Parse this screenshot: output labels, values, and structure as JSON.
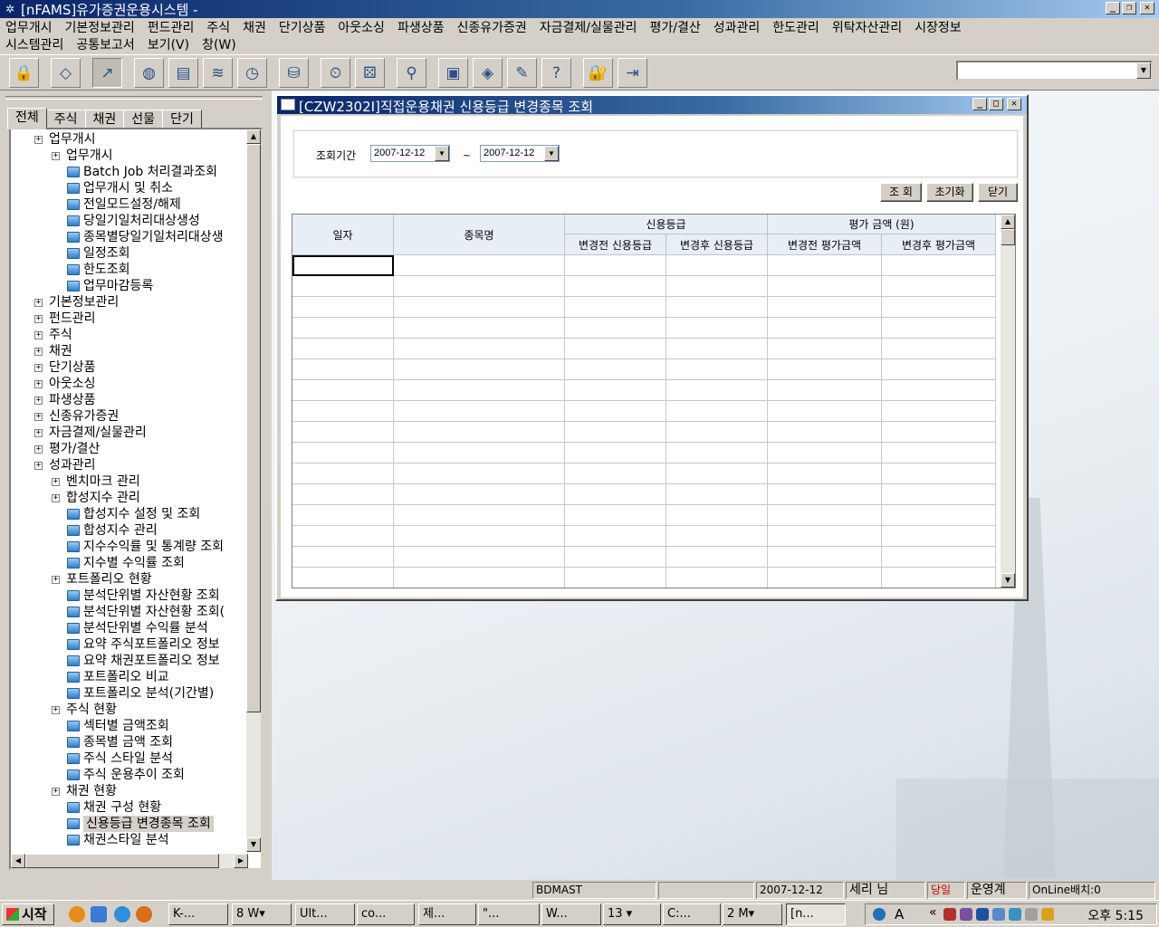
{
  "window": {
    "title": "[nFAMS]유가증권운용시스템 -"
  },
  "menu": {
    "row1": [
      "업무개시",
      "기본정보관리",
      "펀드관리",
      "주식",
      "채권",
      "단기상품",
      "아웃소싱",
      "파생상품",
      "신종유가증권",
      "자금결제/실물관리",
      "평가/결산",
      "성과관리",
      "한도관리",
      "위탁자산관리",
      "시장정보"
    ],
    "row2": [
      "시스템관리",
      "공통보고서",
      "보기(V)",
      "창(W)"
    ]
  },
  "toolbar": {
    "icons": [
      "lock-icon",
      "eraser-icon",
      "navigate-icon",
      "globe-icon",
      "document-refresh-icon",
      "stack-icon",
      "document-clock-icon",
      "database-icon",
      "clock-icon",
      "dice-icon",
      "search-icon",
      "box-icon",
      "package-icon",
      "clipboard-icon",
      "help-icon",
      "padlock-icon",
      "exit-icon"
    ],
    "combo_value": ""
  },
  "left_panel": {
    "tabs": [
      "전체",
      "주식",
      "채권",
      "선물",
      "단기"
    ],
    "active_tab": "전체",
    "tree": [
      {
        "label": "업무개시",
        "level": 0,
        "type": "folder"
      },
      {
        "label": "업무개시",
        "level": 1,
        "type": "folder"
      },
      {
        "label": "Batch Job 처리결과조회",
        "level": 2,
        "type": "doc"
      },
      {
        "label": "업무개시 및 취소",
        "level": 2,
        "type": "doc"
      },
      {
        "label": "전일모드설정/해제",
        "level": 2,
        "type": "doc"
      },
      {
        "label": "당일기일처리대상생성",
        "level": 2,
        "type": "doc"
      },
      {
        "label": "종목별당일기일처리대상생",
        "level": 2,
        "type": "doc"
      },
      {
        "label": "일정조회",
        "level": 2,
        "type": "doc"
      },
      {
        "label": "한도조회",
        "level": 2,
        "type": "doc"
      },
      {
        "label": "업무마감등록",
        "level": 2,
        "type": "doc"
      },
      {
        "label": "기본정보관리",
        "level": 0,
        "type": "folder"
      },
      {
        "label": "펀드관리",
        "level": 0,
        "type": "folder"
      },
      {
        "label": "주식",
        "level": 0,
        "type": "folder"
      },
      {
        "label": "채권",
        "level": 0,
        "type": "folder"
      },
      {
        "label": "단기상품",
        "level": 0,
        "type": "folder"
      },
      {
        "label": "아웃소싱",
        "level": 0,
        "type": "folder"
      },
      {
        "label": "파생상품",
        "level": 0,
        "type": "folder"
      },
      {
        "label": "신종유가증권",
        "level": 0,
        "type": "folder"
      },
      {
        "label": "자금결제/실물관리",
        "level": 0,
        "type": "folder"
      },
      {
        "label": "평가/결산",
        "level": 0,
        "type": "folder"
      },
      {
        "label": "성과관리",
        "level": 0,
        "type": "folder"
      },
      {
        "label": "벤치마크 관리",
        "level": 1,
        "type": "folder"
      },
      {
        "label": "합성지수 관리",
        "level": 1,
        "type": "folder"
      },
      {
        "label": "합성지수 설정 및 조회",
        "level": 2,
        "type": "doc"
      },
      {
        "label": "합성지수 관리",
        "level": 2,
        "type": "doc"
      },
      {
        "label": "지수수익률 및 통계량 조회",
        "level": 2,
        "type": "doc"
      },
      {
        "label": "지수별 수익률 조회",
        "level": 2,
        "type": "doc"
      },
      {
        "label": "포트폴리오 현황",
        "level": 1,
        "type": "folder"
      },
      {
        "label": "분석단위별 자산현황 조회",
        "level": 2,
        "type": "doc"
      },
      {
        "label": "분석단위별 자산현황 조회(",
        "level": 2,
        "type": "doc"
      },
      {
        "label": "분석단위별 수익률 분석",
        "level": 2,
        "type": "doc"
      },
      {
        "label": "요약 주식포트폴리오 정보",
        "level": 2,
        "type": "doc"
      },
      {
        "label": "요약 채권포트폴리오 정보",
        "level": 2,
        "type": "doc"
      },
      {
        "label": "포트폴리오 비교",
        "level": 2,
        "type": "doc"
      },
      {
        "label": "포트폴리오 분석(기간별)",
        "level": 2,
        "type": "doc"
      },
      {
        "label": "주식 현황",
        "level": 1,
        "type": "folder"
      },
      {
        "label": "섹터별 금액조회",
        "level": 2,
        "type": "doc"
      },
      {
        "label": "종목별 금액 조회",
        "level": 2,
        "type": "doc"
      },
      {
        "label": "주식 스타일 분석",
        "level": 2,
        "type": "doc"
      },
      {
        "label": "주식 운용추이 조회",
        "level": 2,
        "type": "doc"
      },
      {
        "label": "채권 현황",
        "level": 1,
        "type": "folder"
      },
      {
        "label": "채권 구성 현황",
        "level": 2,
        "type": "doc"
      },
      {
        "label": "신용등급 변경종목 조회",
        "level": 2,
        "type": "doc",
        "selected": true
      },
      {
        "label": "채권스타일 분석",
        "level": 2,
        "type": "doc"
      }
    ]
  },
  "child_window": {
    "title": "[CZW2302I]직접운용채권 신용등급 변경종목 조회",
    "filter_label": "조회기간",
    "date_from": "2007-12-12",
    "date_to": "2007-12-12",
    "tilde": "~",
    "buttons": {
      "query": "조 회",
      "reset": "초기화",
      "close": "닫기"
    },
    "grid": {
      "col_date": "일자",
      "col_name": "종목명",
      "group_credit": "신용등급",
      "group_value": "평가 금액 (원)",
      "col_credit_before": "변경전 신용등급",
      "col_credit_after": "변경후 신용등급",
      "col_value_before": "변경전 평가금액",
      "col_value_after": "변경후 평가금액",
      "rows": 16
    }
  },
  "statusbar": {
    "server": "BDMAST",
    "empty1": "",
    "date": "2007-12-12",
    "user": "세리 님",
    "day_flag": "당일",
    "mode": "운영계",
    "online_batch": "OnLine배치:0"
  },
  "taskbar": {
    "start_label": "시작",
    "tasks": [
      "K-...",
      "8 W▾",
      "Ult...",
      "co...",
      "제...",
      "\"...",
      "W...",
      "13 ▾",
      "C:...",
      "2 M▾",
      "[n..."
    ],
    "tray_letters": "A",
    "clock": "오후 5:15"
  }
}
